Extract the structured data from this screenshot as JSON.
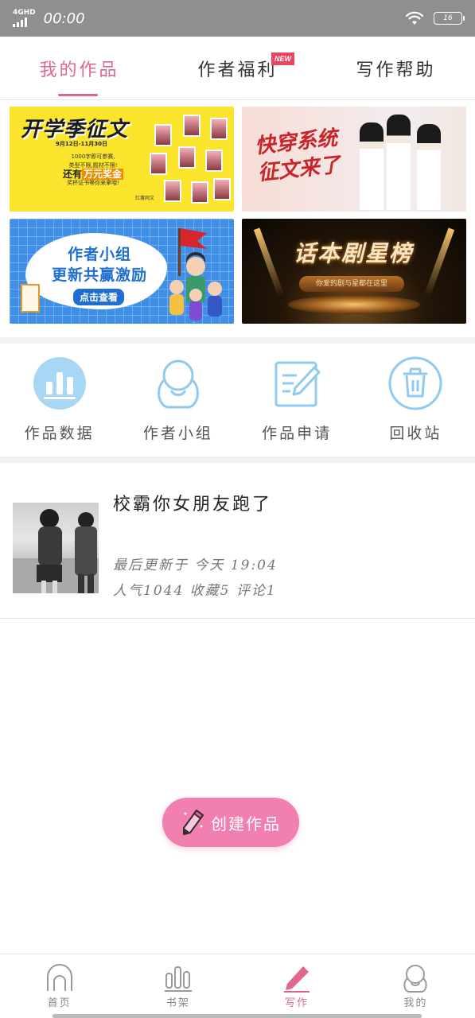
{
  "status_bar": {
    "network": "4GHD",
    "time": "00:00",
    "battery": "16"
  },
  "tabs": [
    {
      "label": "我的作品",
      "active": true
    },
    {
      "label": "作者福利",
      "badge": "NEW"
    },
    {
      "label": "写作帮助"
    }
  ],
  "banners": {
    "b1": {
      "title": "开学季征文",
      "date": "9月12日-11月30日",
      "line1": "1000字即可参赛,",
      "line2": "类型不限,题材不限!",
      "line3_pre": "还有",
      "line3_hl": "万元奖金",
      "line4": "奖杯证书等你来拿哦!",
      "logo": "红薯网文"
    },
    "b2": {
      "title_l1": "快穿系统",
      "title_l2": "征文来了"
    },
    "b3": {
      "line1": "作者小组",
      "line2": "更新共赢激励",
      "button": "点击查看"
    },
    "b4": {
      "title": "话本剧星榜",
      "subtitle": "你爱的剧与星都在这里"
    }
  },
  "actions": [
    {
      "label": "作品数据",
      "icon": "bar-chart-icon"
    },
    {
      "label": "作者小组",
      "icon": "group-icon"
    },
    {
      "label": "作品申请",
      "icon": "edit-note-icon"
    },
    {
      "label": "回收站",
      "icon": "trash-icon"
    }
  ],
  "work": {
    "title": "校霸你女朋友跑了",
    "updated": "最后更新于 今天 19:04",
    "stats": "人气1044 收藏5 评论1"
  },
  "create_button": {
    "label": "创建作品",
    "icon": "pencil-icon"
  },
  "bottom_nav": [
    {
      "label": "首页",
      "icon": "home-icon"
    },
    {
      "label": "书架",
      "icon": "bookshelf-icon"
    },
    {
      "label": "写作",
      "icon": "pen-icon",
      "active": true
    },
    {
      "label": "我的",
      "icon": "profile-icon"
    }
  ],
  "colors": {
    "accent": "#e0668a",
    "button": "#f17fb0",
    "icon_blue": "#8fcaf0",
    "badge": "#e8465e"
  }
}
